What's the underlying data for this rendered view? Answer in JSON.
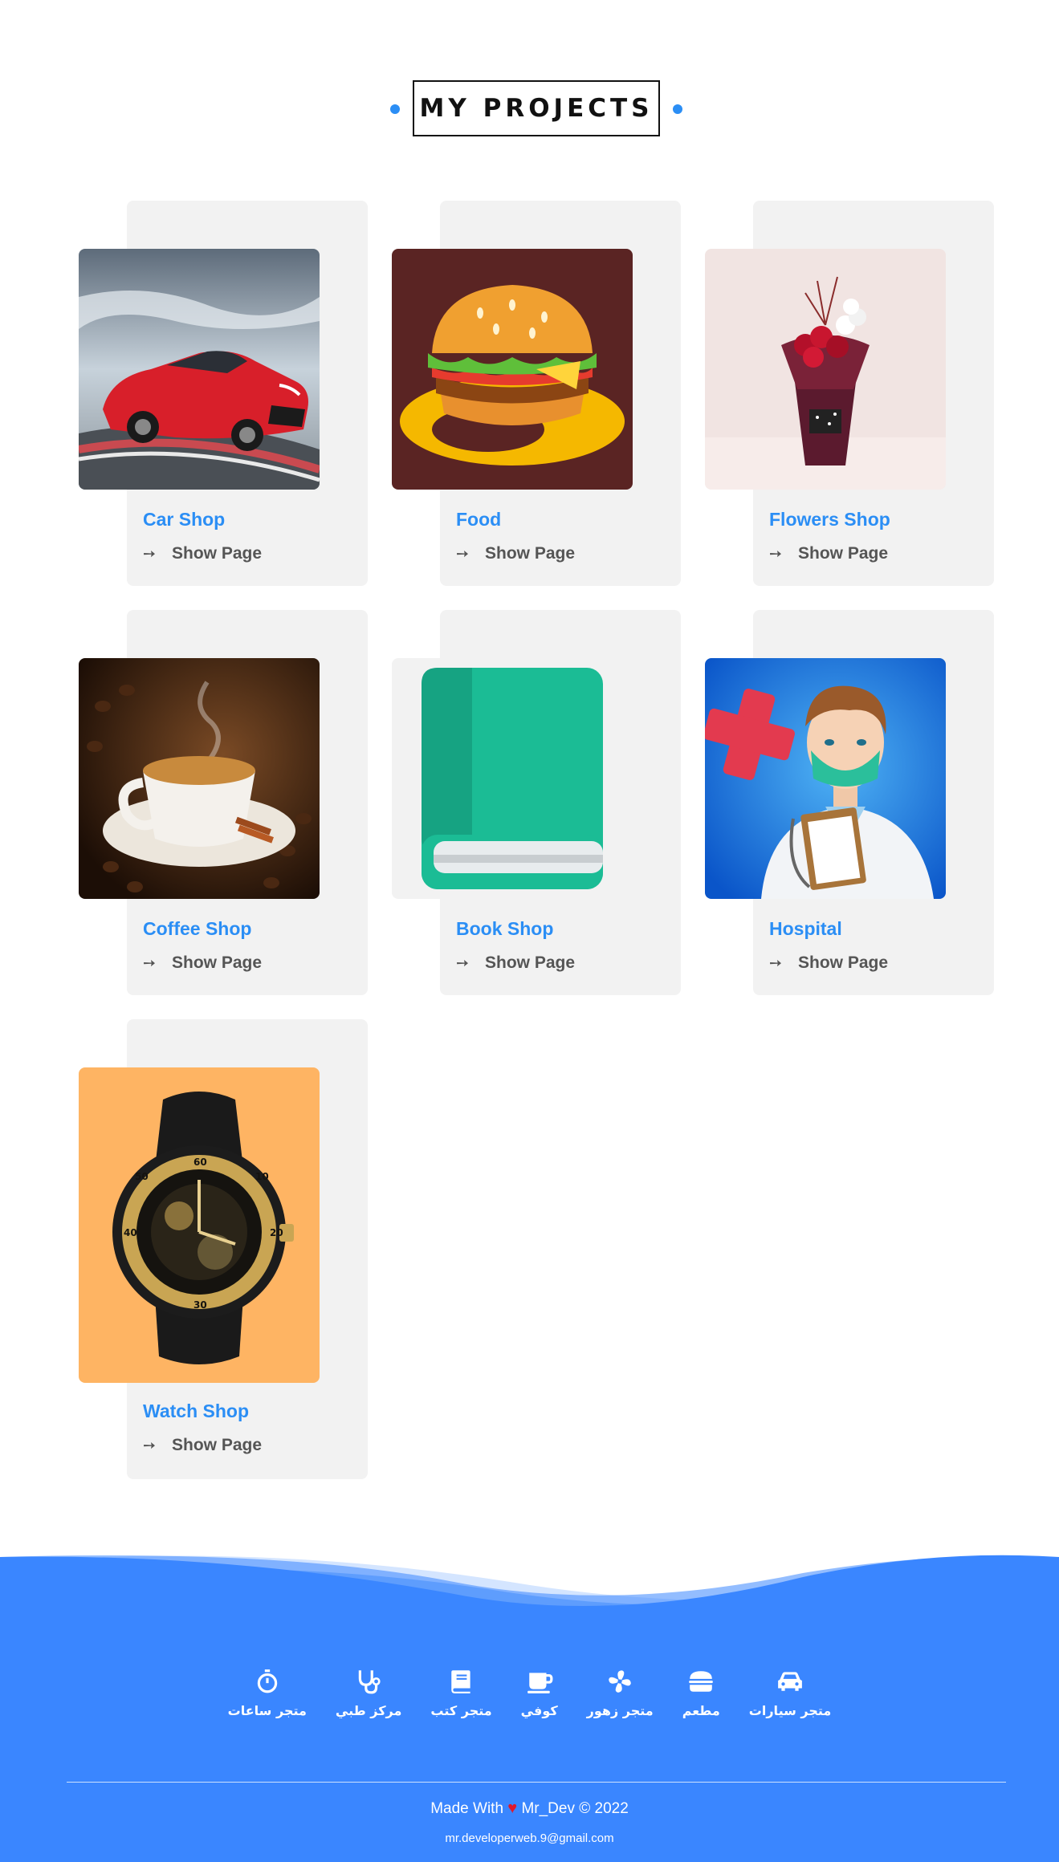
{
  "section": {
    "title": "MY PROJECTS"
  },
  "projects": [
    {
      "title": "Car Shop",
      "link_label": "Show Page",
      "image": "red-sports-car"
    },
    {
      "title": "Food",
      "link_label": "Show Page",
      "image": "burger"
    },
    {
      "title": "Flowers Shop",
      "link_label": "Show Page",
      "image": "flower-bouquet"
    },
    {
      "title": "Coffee Shop",
      "link_label": "Show Page",
      "image": "coffee-cup"
    },
    {
      "title": "Book Shop",
      "link_label": "Show Page",
      "image": "green-book"
    },
    {
      "title": "Hospital",
      "link_label": "Show Page",
      "image": "doctor"
    },
    {
      "title": "Watch Shop",
      "link_label": "Show Page",
      "image": "gold-watch"
    }
  ],
  "footer": {
    "nav": [
      {
        "label": "متجر سيارات",
        "icon": "car-icon"
      },
      {
        "label": "مطعم",
        "icon": "burger-icon"
      },
      {
        "label": "متجر زهور",
        "icon": "fan-icon"
      },
      {
        "label": "كوفي",
        "icon": "mug-icon"
      },
      {
        "label": "متجر كتب",
        "icon": "book-icon"
      },
      {
        "label": "مركز طبي",
        "icon": "stethoscope-icon"
      },
      {
        "label": "متجر ساعات",
        "icon": "stopwatch-icon"
      }
    ],
    "made_prefix": "Made With",
    "made_suffix": "Mr_Dev © 2022",
    "email": "mr.developerweb.9@gmail.com"
  },
  "colors": {
    "accent": "#2b8ef5",
    "footer_blue": "#3a86ff",
    "card_bg": "#f2f2f2",
    "heart": "#e0182b"
  }
}
